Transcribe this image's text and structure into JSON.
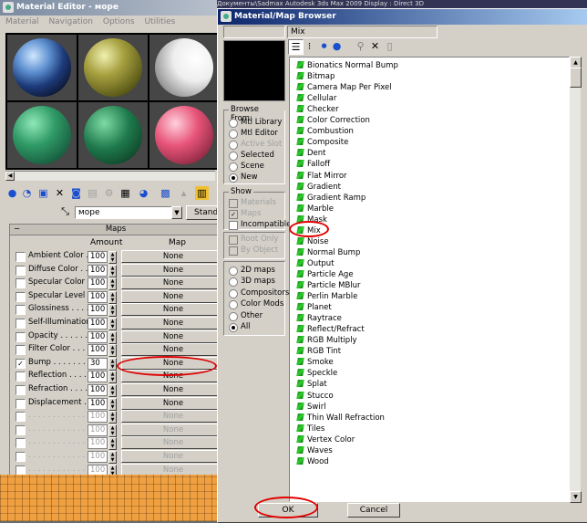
{
  "material_editor": {
    "title": "Material Editor - море",
    "menu": [
      "Material",
      "Navigation",
      "Options",
      "Utilities"
    ],
    "material_name": "море",
    "type_button": "Stand",
    "maps_rollout": {
      "title": "Maps",
      "col_amount": "Amount",
      "col_map": "Map",
      "rows": [
        {
          "label": "Ambient Color . .",
          "amount": "100",
          "map": "None",
          "checked": false
        },
        {
          "label": "Diffuse Color . . .",
          "amount": "100",
          "map": "None",
          "checked": false
        },
        {
          "label": "Specular Color . .",
          "amount": "100",
          "map": "None",
          "checked": false
        },
        {
          "label": "Specular Level . .",
          "amount": "100",
          "map": "None",
          "checked": false
        },
        {
          "label": "Glossiness . . . . .",
          "amount": "100",
          "map": "None",
          "checked": false
        },
        {
          "label": "Self-Illumination . .",
          "amount": "100",
          "map": "None",
          "checked": false
        },
        {
          "label": "Opacity . . . . . . .",
          "amount": "100",
          "map": "None",
          "checked": false
        },
        {
          "label": "Filter Color . . . .",
          "amount": "100",
          "map": "None",
          "checked": false
        },
        {
          "label": "Bump . . . . . . . .",
          "amount": "30",
          "map": "None",
          "checked": true
        },
        {
          "label": "Reflection . . . . .",
          "amount": "100",
          "map": "None",
          "checked": false
        },
        {
          "label": "Refraction . . . . .",
          "amount": "100",
          "map": "None",
          "checked": false
        },
        {
          "label": "Displacement . . .",
          "amount": "100",
          "map": "None",
          "checked": false
        },
        {
          "label": ". . . . . . . . . . . .",
          "amount": "100",
          "map": "None",
          "checked": false
        },
        {
          "label": ". . . . . . . . . . . .",
          "amount": "100",
          "map": "None",
          "checked": false
        },
        {
          "label": ". . . . . . . . . . . .",
          "amount": "100",
          "map": "None",
          "checked": false
        },
        {
          "label": ". . . . . . . . . . . .",
          "amount": "100",
          "map": "None",
          "checked": false
        },
        {
          "label": ". . . . . . . . . . . .",
          "amount": "100",
          "map": "None",
          "checked": false
        }
      ]
    }
  },
  "top_strip_text": "Документы\\Sadmax     Autodesk 3ds Max 2009     Display : Direct 3D",
  "browser": {
    "title": "Material/Map Browser",
    "search_value": "Mix",
    "browse_from": {
      "title": "Browse From:",
      "options": [
        {
          "label": "Mtl Library",
          "selected": false,
          "disabled": false
        },
        {
          "label": "Mtl Editor",
          "selected": false,
          "disabled": false
        },
        {
          "label": "Active Slot",
          "selected": false,
          "disabled": true
        },
        {
          "label": "Selected",
          "selected": false,
          "disabled": false
        },
        {
          "label": "Scene",
          "selected": false,
          "disabled": false
        },
        {
          "label": "New",
          "selected": true,
          "disabled": false
        }
      ]
    },
    "show": {
      "title": "Show",
      "options": [
        {
          "label": "Materials",
          "checked": false,
          "disabled": true
        },
        {
          "label": "Maps",
          "checked": true,
          "disabled": true
        },
        {
          "label": "Incompatible",
          "checked": false,
          "disabled": false
        }
      ],
      "extra": [
        {
          "label": "Root Only",
          "checked": false,
          "disabled": true
        },
        {
          "label": "By Object",
          "checked": false,
          "disabled": true
        }
      ]
    },
    "map_filter": [
      {
        "label": "2D maps",
        "selected": false
      },
      {
        "label": "3D maps",
        "selected": false
      },
      {
        "label": "Compositors",
        "selected": false
      },
      {
        "label": "Color Mods",
        "selected": false
      },
      {
        "label": "Other",
        "selected": false
      },
      {
        "label": "All",
        "selected": true
      }
    ],
    "maps": [
      "Bionatics Normal Bump",
      "Bitmap",
      "Camera Map Per Pixel",
      "Cellular",
      "Checker",
      "Color Correction",
      "Combustion",
      "Composite",
      "Dent",
      "Falloff",
      "Flat Mirror",
      "Gradient",
      "Gradient Ramp",
      "Marble",
      "Mask",
      "Mix",
      "Noise",
      "Normal Bump",
      "Output",
      "Particle Age",
      "Particle MBlur",
      "Perlin Marble",
      "Planet",
      "Raytrace",
      "Reflect/Refract",
      "RGB Multiply",
      "RGB Tint",
      "Smoke",
      "Speckle",
      "Splat",
      "Stucco",
      "Swirl",
      "Thin Wall Refraction",
      "Tiles",
      "Vertex Color",
      "Waves",
      "Wood"
    ],
    "ok_label": "OK",
    "cancel_label": "Cancel"
  },
  "highlight_color": "#e00000"
}
